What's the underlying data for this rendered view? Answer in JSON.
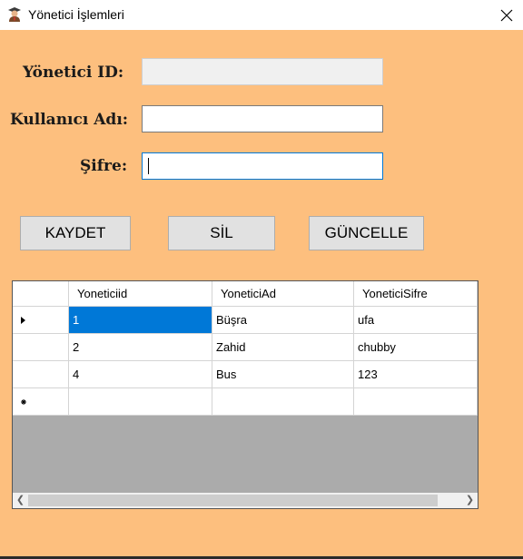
{
  "window": {
    "title": "Yönetici İşlemleri",
    "icon": "admin-user-icon"
  },
  "form": {
    "id_label": "Yönetici ID:",
    "id_value": "",
    "username_label": "Kullanıcı Adı:",
    "username_value": "",
    "password_label": "Şifre:",
    "password_value": ""
  },
  "buttons": {
    "save": "KAYDET",
    "delete": "SİL",
    "update": "GÜNCELLE"
  },
  "grid": {
    "columns": [
      "Yoneticiid",
      "YoneticiAd",
      "YoneticiSifre"
    ],
    "rows": [
      [
        "1",
        "Büşra",
        "ufa"
      ],
      [
        "2",
        "Zahid",
        "chubby"
      ],
      [
        "4",
        "Bus",
        "123"
      ]
    ],
    "selected_row": 0
  },
  "colors": {
    "form_background": "#fdbf7e",
    "selection": "#0078d7",
    "grid_background": "#ababab"
  }
}
